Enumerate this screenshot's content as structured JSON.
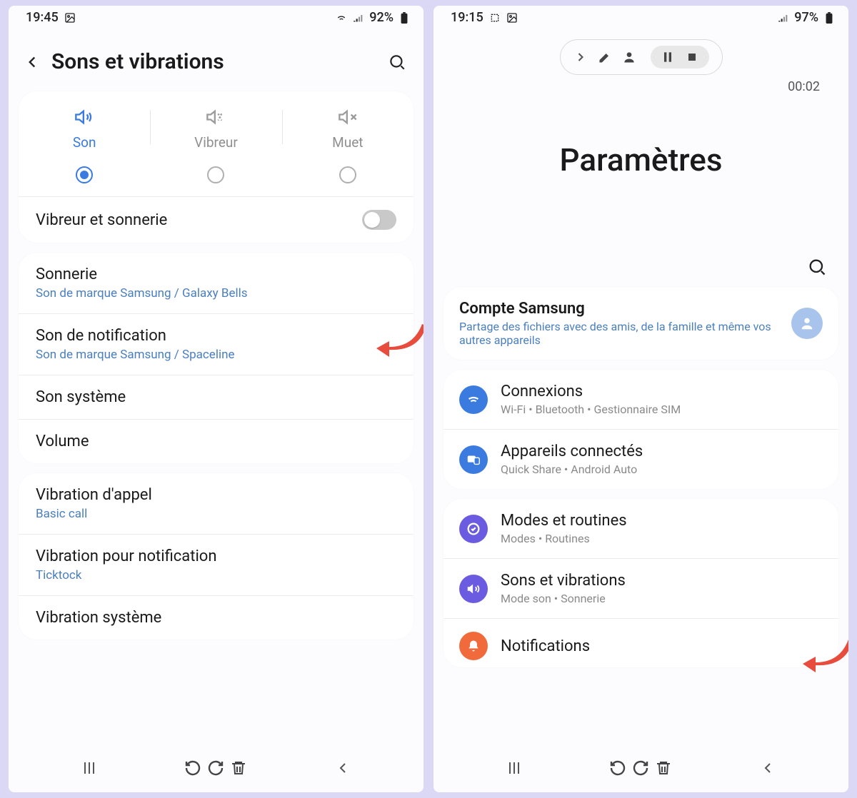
{
  "left": {
    "status": {
      "time": "19:45",
      "battery": "92%"
    },
    "header": {
      "title": "Sons et vibrations"
    },
    "modes": {
      "sound": "Son",
      "vibrate": "Vibreur",
      "mute": "Muet"
    },
    "vibrateRing": "Vibreur et sonnerie",
    "items": {
      "ringtone": {
        "title": "Sonnerie",
        "sub": "Son de marque Samsung / Galaxy Bells"
      },
      "notif": {
        "title": "Son de notification",
        "sub": "Son de marque Samsung / Spaceline"
      },
      "system": {
        "title": "Son système"
      },
      "volume": {
        "title": "Volume"
      },
      "vibCall": {
        "title": "Vibration d'appel",
        "sub": "Basic call"
      },
      "vibNotif": {
        "title": "Vibration pour notification",
        "sub": "Ticktock"
      },
      "vibSystem": {
        "title": "Vibration système"
      }
    }
  },
  "right": {
    "status": {
      "time": "19:15",
      "battery": "97%"
    },
    "recTime": "00:02",
    "bigTitle": "Paramètres",
    "account": {
      "title": "Compte Samsung",
      "sub": "Partage des fichiers avec des amis, de la famille et même vos autres appareils"
    },
    "items": {
      "connections": {
        "title": "Connexions",
        "sub": "Wi-Fi  •  Bluetooth  •  Gestionnaire SIM"
      },
      "devices": {
        "title": "Appareils connectés",
        "sub": "Quick Share  •  Android Auto"
      },
      "modes": {
        "title": "Modes et routines",
        "sub": "Modes  •  Routines"
      },
      "sounds": {
        "title": "Sons et vibrations",
        "sub": "Mode son  •  Sonnerie"
      },
      "notifs": {
        "title": "Notifications"
      }
    },
    "colors": {
      "connections": "#3b7be0",
      "devices": "#3b7be0",
      "modes": "#6a5be0",
      "sounds": "#6a5be0",
      "notifs": "#f06a3b"
    }
  }
}
